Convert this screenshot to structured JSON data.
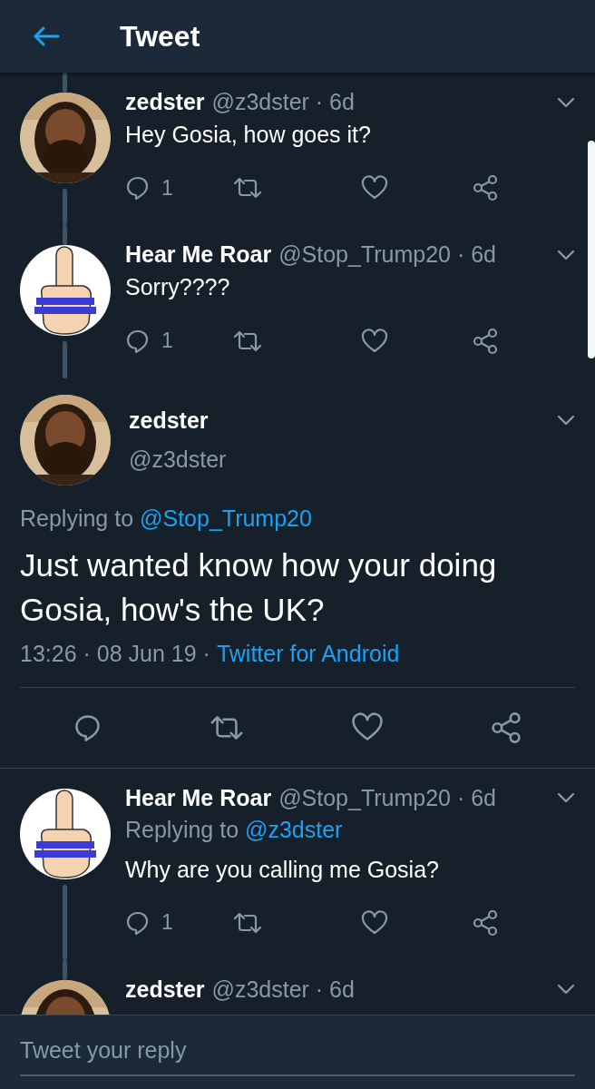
{
  "header": {
    "title": "Tweet"
  },
  "tweets": [
    {
      "kind": "reply",
      "name": "zedster",
      "meta": "@z3dster · 6d",
      "text": "Hey Gosia, how goes it?",
      "line_above": true,
      "line_below": true,
      "actions": {
        "reply_count": "1"
      }
    },
    {
      "kind": "reply",
      "name": "Hear Me Roar",
      "meta": "@Stop_Trump20 · 6d",
      "text": "Sorry????",
      "line_above": true,
      "line_below": true,
      "actions": {
        "reply_count": "1"
      }
    },
    {
      "kind": "focused",
      "name": "zedster",
      "handle": "@z3dster",
      "replying_to": {
        "label": "Replying to",
        "handle": "@Stop_Trump20"
      },
      "text": "Just wanted know how your doing Gosia, how's the UK?",
      "timestamp": "13:26 · 08 Jun 19 ·",
      "source": "Twitter for Android"
    },
    {
      "kind": "reply",
      "name": "Hear Me Roar",
      "meta": "@Stop_Trump20 · 6d",
      "replying_to": {
        "label": "Replying to",
        "handle": "@z3dster"
      },
      "text": "Why are you calling me Gosia?",
      "line_above": false,
      "line_below": true,
      "actions": {
        "reply_count": "1"
      }
    },
    {
      "kind": "reply",
      "name": "zedster",
      "meta": "@z3dster · 6d",
      "line_above": true,
      "line_below": false
    }
  ],
  "reply_bar": {
    "placeholder": "Tweet your reply"
  }
}
